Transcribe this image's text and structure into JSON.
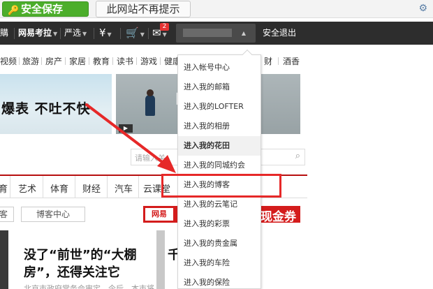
{
  "password_bar": {
    "save_label": "安全保存",
    "never_label": "此网站不再提示"
  },
  "nav": {
    "items": [
      "購",
      "网易考拉",
      "严选",
      "¥",
      "",
      "",
      "安全退出"
    ],
    "mail_badge": "2"
  },
  "categories": [
    "视频",
    "旅游",
    "房产",
    "家居",
    "教育",
    "读书",
    "游戏",
    "健康",
    "财",
    "酒香"
  ],
  "banner": {
    "left_text": "爆表 不吐不快"
  },
  "search": {
    "placeholder": "请输入关"
  },
  "channel_tabs": [
    "育",
    "艺术",
    "体育",
    "财经",
    "汽车",
    "云课堂"
  ],
  "sub_tabs": [
    "客",
    "博客中心"
  ],
  "ad": {
    "logo": "网易",
    "text": "现金券"
  },
  "articles": [
    {
      "title": "没了“前世”的“大棚房”，还得关注它",
      "sub": "北京市政府常务会审定…今后，本市将"
    },
    {
      "title": "千…行行餐换…",
      "sub": "…"
    }
  ],
  "dropdown": {
    "items": [
      "进入帐号中心",
      "进入我的邮箱",
      "进入我的LOFTER",
      "进入我的相册",
      "进入我的花田",
      "进入我的同城约会",
      "进入我的博客",
      "进入我的云笔记",
      "进入我的彩票",
      "进入我的贵金属",
      "进入我的车险",
      "进入我的保险"
    ],
    "highlighted_index": 4,
    "annotated_index": 6
  },
  "colors": {
    "save_green": "#4cae2b",
    "nav_dark": "#2d2d2d",
    "brand_red": "#b70f0f",
    "annotation_red": "#e62828"
  }
}
